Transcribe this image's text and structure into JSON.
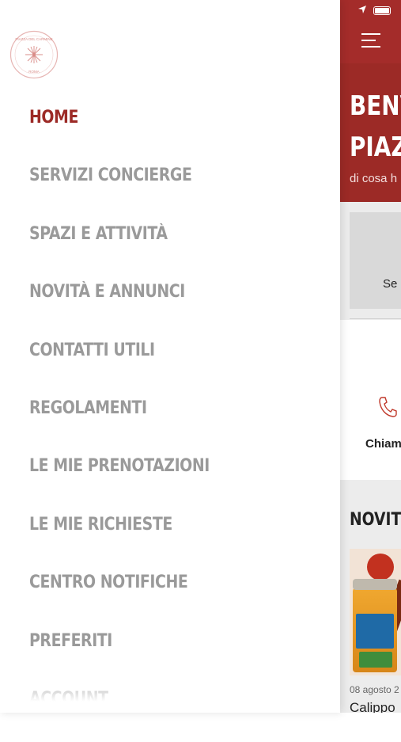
{
  "drawer": {
    "logo": {
      "text_top": "PIAZZA DEL CARMINE",
      "text_bottom": "ROMA"
    },
    "items": [
      {
        "label": "HOME",
        "active": true
      },
      {
        "label": "SERVIZI CONCIERGE",
        "active": false
      },
      {
        "label": "SPAZI E ATTIVITÀ",
        "active": false
      },
      {
        "label": "NOVITÀ E ANNUNCI",
        "active": false
      },
      {
        "label": "CONTATTI UTILI",
        "active": false
      },
      {
        "label": "REGOLAMENTI",
        "active": false
      },
      {
        "label": "LE MIE PRENOTAZIONI",
        "active": false
      },
      {
        "label": "LE MIE RICHIESTE",
        "active": false
      },
      {
        "label": "CENTRO NOTIFICHE",
        "active": false
      },
      {
        "label": "PREFERITI",
        "active": false
      },
      {
        "label": "ACCOUNT",
        "active": false
      }
    ]
  },
  "app": {
    "hero_title_line1": "BENV",
    "hero_title_line2": "PIAZ",
    "hero_subtitle": "di cosa h",
    "card1_label": "Se",
    "card2_label": "Chiam",
    "section_title": "NOVIT",
    "news": {
      "date": "08 agosto 2",
      "title": "Calippo"
    }
  },
  "colors": {
    "accent": "#9c2a26",
    "inactive": "#9a9a9a",
    "topbar": "#a42c2a"
  },
  "icons": {
    "location": "location-arrow-icon",
    "battery": "battery-icon",
    "menu": "hamburger-menu-icon",
    "phone": "phone-icon"
  }
}
